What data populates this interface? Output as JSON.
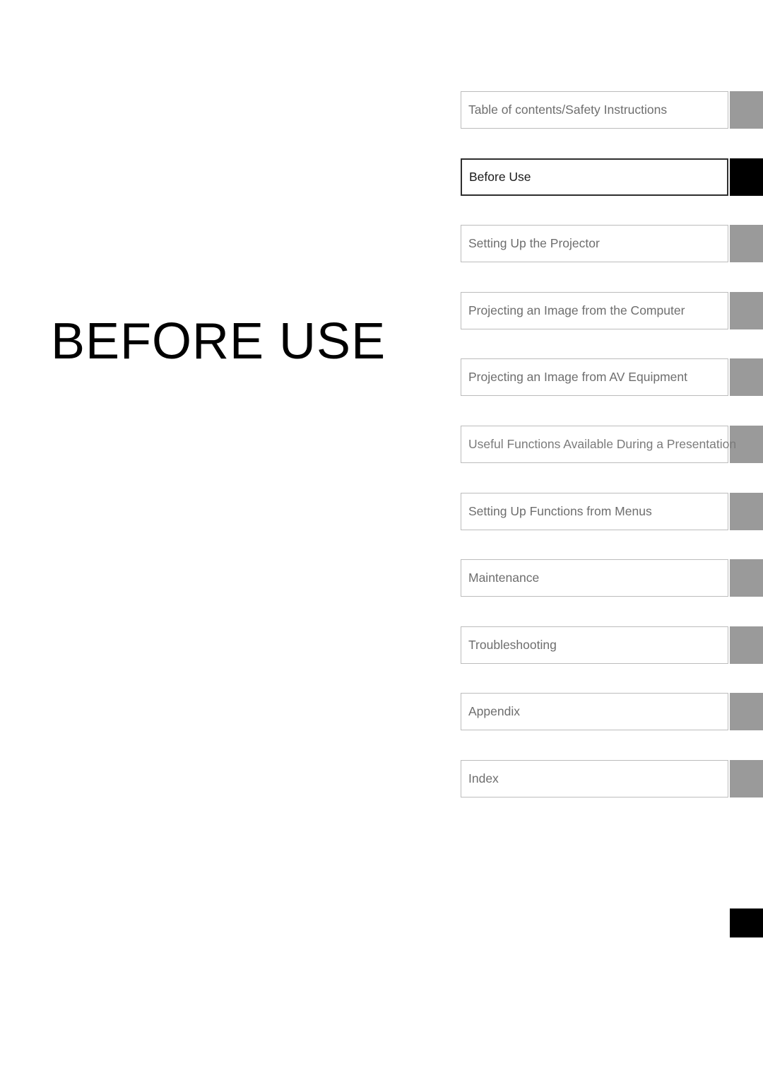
{
  "page": {
    "section_title": "BEFORE USE",
    "background_color": "#ffffff"
  },
  "colors": {
    "marker_inactive": "#9a9a9a",
    "marker_active": "#000000",
    "plate_border_inactive": "#bcbcbc",
    "plate_border_active": "#2e2e2e",
    "label_inactive": "#6e6e6e",
    "label_active": "#1a1a1a",
    "title": "#000000"
  },
  "tab_index": {
    "tabs": [
      {
        "label": "Table of contents/Safety Instructions",
        "active": false,
        "overflow": false
      },
      {
        "label": "Before Use",
        "active": true,
        "overflow": false
      },
      {
        "label": "Setting Up the Projector",
        "active": false,
        "overflow": false
      },
      {
        "label": "Projecting an Image from the Computer",
        "active": false,
        "overflow": false
      },
      {
        "label": "Projecting an Image from AV Equipment",
        "active": false,
        "overflow": false
      },
      {
        "label": "Useful Functions Available During a Presentation",
        "active": false,
        "overflow": true
      },
      {
        "label": "Setting Up Functions from Menus",
        "active": false,
        "overflow": false
      },
      {
        "label": "Maintenance",
        "active": false,
        "overflow": false
      },
      {
        "label": "Troubleshooting",
        "active": false,
        "overflow": false
      },
      {
        "label": "Appendix",
        "active": false,
        "overflow": false
      },
      {
        "label": "Index",
        "active": false,
        "overflow": false
      }
    ]
  },
  "corner_marker": {
    "name": "page-edge-marker"
  }
}
